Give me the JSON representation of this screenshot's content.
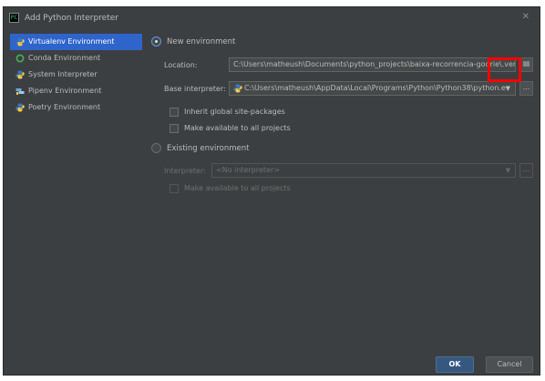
{
  "window": {
    "title": "Add Python Interpreter",
    "close_glyph": "✕"
  },
  "sidebar": {
    "items": [
      {
        "label": "Virtualenv Environment",
        "icon": "python-icon",
        "selected": true
      },
      {
        "label": "Conda Environment",
        "icon": "conda-icon"
      },
      {
        "label": "System Interpreter",
        "icon": "python-icon"
      },
      {
        "label": "Pipenv Environment",
        "icon": "pipenv-icon"
      },
      {
        "label": "Poetry Environment",
        "icon": "python-icon"
      }
    ]
  },
  "new_env": {
    "radio_label": "New environment",
    "location_label": "Location:",
    "location_value": "C:\\Users\\matheush\\Documents\\python_projects\\baixa-recorrencia-godri",
    "location_suffix": "e\\.venv",
    "base_label": "Base interpreter:",
    "base_value": "C:\\Users\\matheush\\AppData\\Local\\Programs\\Python\\Python38\\python.e",
    "inherit_label": "Inherit global site-packages",
    "available_label": "Make available to all projects",
    "browse_glyph": "..."
  },
  "existing_env": {
    "radio_label": "Existing environment",
    "interpreter_label": "Interpreter:",
    "interpreter_value": "<No interpreter>",
    "available_label": "Make available to all projects",
    "browse_glyph": "..."
  },
  "buttons": {
    "ok": "OK",
    "cancel": "Cancel"
  },
  "colors": {
    "accent": "#2f65ca",
    "highlight": "#ff0000",
    "python_blue": "#3a78bf",
    "python_yellow": "#f7c948"
  }
}
